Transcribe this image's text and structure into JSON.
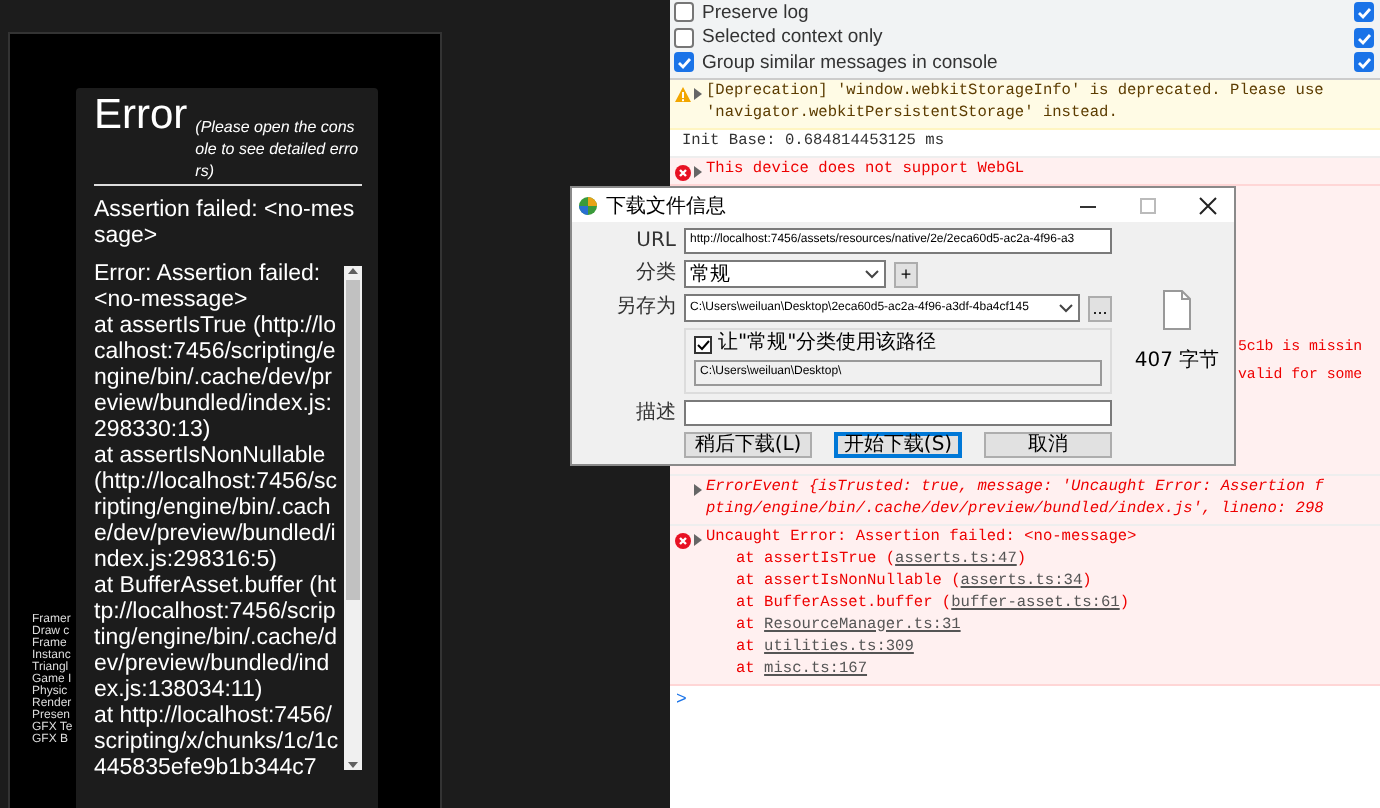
{
  "game_preview": {
    "stats": [
      "Framer",
      "Draw c",
      "Frame",
      "Instanc",
      "Triangl",
      "Game I",
      "Physic",
      "Render",
      "Presen",
      "GFX Te",
      "GFX B"
    ],
    "error_card": {
      "title": "Error",
      "subtitle": "(Please open the console to see detailed errors)",
      "message": "Assertion failed: <no-message>",
      "stack": [
        "Error: Assertion failed: <no-message>",
        "at assertIsTrue (http://localhost:7456/scripting/engine/bin/.cache/dev/preview/bundled/index.js:298330:13)",
        "at assertIsNonNullable (http://localhost:7456/scripting/engine/bin/.cache/dev/preview/bundled/index.js:298316:5)",
        "at BufferAsset.buffer (http://localhost:7456/scripting/engine/bin/.cache/dev/preview/bundled/index.js:138034:11)",
        "at http://localhost:7456/scripting/x/chunks/1c/1c445835efe9b1b344c7"
      ]
    }
  },
  "devtools": {
    "settings": [
      {
        "label": "Preserve log",
        "checked": false
      },
      {
        "label": "Selected context only",
        "checked": false
      },
      {
        "label": "Group similar messages in console",
        "checked": true
      }
    ],
    "settings_right": [
      {
        "checked": true
      },
      {
        "checked": true
      },
      {
        "checked": true
      }
    ],
    "messages": [
      {
        "kind": "warning",
        "lines": [
          "[Deprecation] 'window.webkitStorageInfo' is deprecated. Please use",
          "'navigator.webkitPersistentStorage' instead."
        ]
      },
      {
        "kind": "log",
        "lines": [
          "Init Base: 0.684814453125 ms"
        ]
      },
      {
        "kind": "error",
        "lines": [
          "This device does not support WebGL"
        ]
      },
      {
        "kind": "covered",
        "lines": [
          "5c1b is missin",
          "valid for some"
        ]
      },
      {
        "kind": "detail",
        "lines": [
          "ErrorEvent {isTrusted: true, message: 'Uncaught Error: Assertion f",
          "pting/engine/bin/.cache/dev/preview/bundled/index.js', lineno: 298"
        ]
      },
      {
        "kind": "error",
        "lines": [
          "Uncaught Error: Assertion failed: <no-message>"
        ],
        "stack": [
          {
            "before": "at assertIsTrue (",
            "link": "asserts.ts:47",
            "after": ")"
          },
          {
            "before": "at assertIsNonNullable (",
            "link": "asserts.ts:34",
            "after": ")"
          },
          {
            "before": "at BufferAsset.buffer (",
            "link": "buffer-asset.ts:61",
            "after": ")"
          },
          {
            "before": "at ",
            "link": "ResourceManager.ts:31"
          },
          {
            "before": "at ",
            "link": "utilities.ts:309"
          },
          {
            "before": "at ",
            "link": "misc.ts:167"
          }
        ]
      }
    ],
    "prompt": ">"
  },
  "dialog": {
    "title": "下载文件信息",
    "url_label": "URL",
    "url": "http://localhost:7456/assets/resources/native/2e/2eca60d5-ac2a-4f96-a3",
    "category_label": "分类",
    "category": "常规",
    "add_button": "+",
    "save_as_label": "另存为",
    "save_as": "C:\\Users\\weiluan\\Desktop\\2eca60d5-ac2a-4f96-a3df-4ba4cf145",
    "browse_button": "...",
    "use_path": {
      "label": "让\"常规\"分类使用该路径",
      "checked": true
    },
    "category_path": "C:\\Users\\weiluan\\Desktop\\",
    "description_label": "描述",
    "file_size": "407 字节",
    "buttons": [
      {
        "label": "稍后下载(L)",
        "default": false
      },
      {
        "label": "开始下载(S)",
        "default": true
      },
      {
        "label": "取消",
        "default": false
      }
    ]
  }
}
